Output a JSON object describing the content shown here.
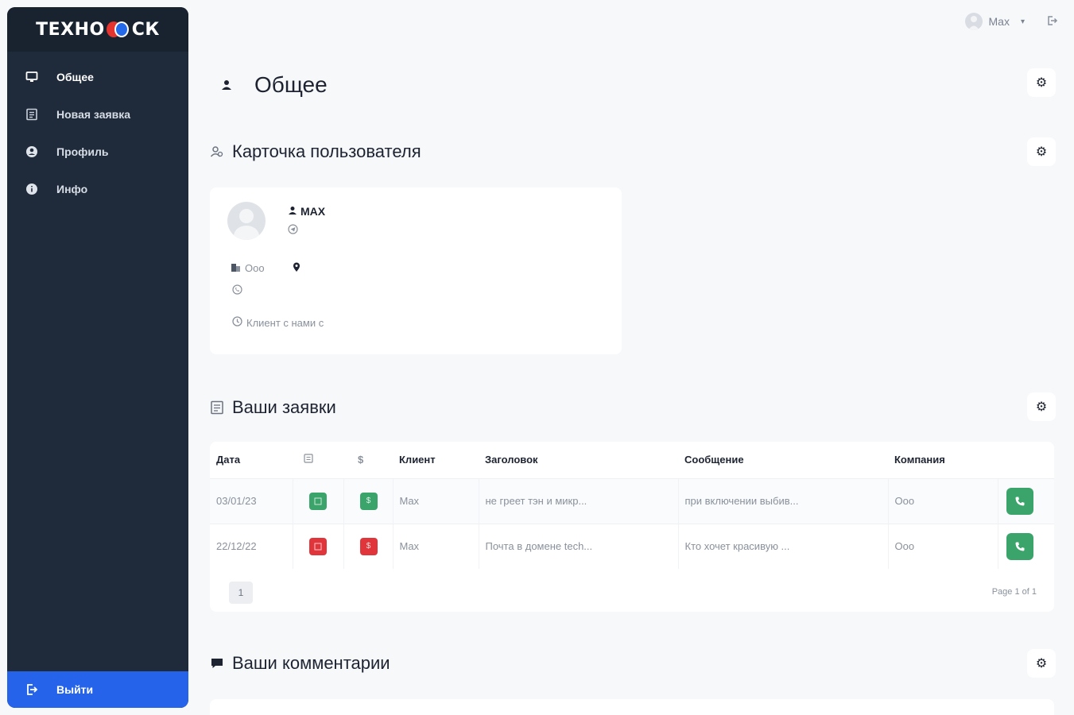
{
  "brand": {
    "left": "ТЕХНО",
    "right": "СК"
  },
  "sidebar": {
    "items": [
      {
        "label": "Общее",
        "icon": "monitor-icon"
      },
      {
        "label": "Новая заявка",
        "icon": "form-icon"
      },
      {
        "label": "Профиль",
        "icon": "profile-icon"
      },
      {
        "label": "Инфо",
        "icon": "info-icon"
      }
    ],
    "logout_label": "Выйти"
  },
  "topbar": {
    "user_name": "Max",
    "dropdown_icon": "chevron-down-icon",
    "exit_icon": "logout-icon"
  },
  "page": {
    "title": "Общее"
  },
  "user_card": {
    "section_title": "Карточка пользователя",
    "name": "MAX",
    "telegram": "",
    "company": "Ооо",
    "location": "",
    "phone": "",
    "since_label": "Клиент с нами с"
  },
  "tickets": {
    "section_title": "Ваши заявки",
    "columns": [
      "Дата",
      "",
      "",
      "Клиент",
      "Заголовок",
      "Сообщение",
      "Компания",
      ""
    ],
    "rows": [
      {
        "date": "03/01/23",
        "client": "Max",
        "title": "не греет тэн и микр...",
        "message": "при включении выбив...",
        "company": "Ооо",
        "status_color": "#3aa46b"
      },
      {
        "date": "22/12/22",
        "client": "Max",
        "title": "Почта в домене tech...",
        "message": "Кто хочет красивую ...",
        "company": "Ооо",
        "status_color": "#e0353a"
      }
    ],
    "pagination": {
      "current": "1",
      "info": "Page 1 of 1"
    }
  },
  "comments": {
    "section_title": "Ваши комментарии"
  },
  "colors": {
    "sidebar": "#1f2a3a",
    "accent": "#2563eb",
    "success": "#3aa46b",
    "danger": "#e0353a"
  }
}
